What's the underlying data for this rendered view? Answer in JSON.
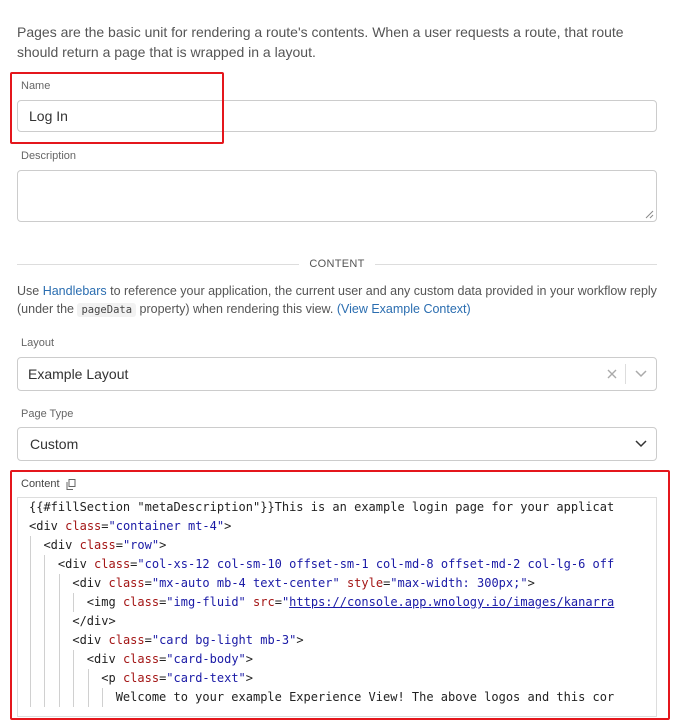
{
  "intro": "Pages are the basic unit for rendering a route's contents. When a user requests a route, that route should return a page that is wrapped in a layout.",
  "name_field": {
    "label": "Name",
    "value": "Log In"
  },
  "description_field": {
    "label": "Description",
    "value": ""
  },
  "content_divider": "CONTENT",
  "content_note": {
    "prefix": "Use ",
    "link_handlebars": "Handlebars",
    "middle": " to reference your application, the current user and any custom data provided in your workflow reply (under the ",
    "code": "pageData",
    "after_code": " property) when rendering this view. ",
    "link_example": "(View Example Context)"
  },
  "layout_field": {
    "label": "Layout",
    "value": "Example Layout"
  },
  "page_type_field": {
    "label": "Page Type",
    "value": "Custom"
  },
  "content_field": {
    "label": "Content"
  },
  "code_lines": [
    "{{#fillSection \"metaDescription\"}}This is an example login page for your applicat",
    "<div class=\"container mt-4\">",
    "  <div class=\"row\">",
    "    <div class=\"col-xs-12 col-sm-10 offset-sm-1 col-md-8 offset-md-2 col-lg-6 off",
    "      <div class=\"mx-auto mb-4 text-center\" style=\"max-width: 300px;\">",
    "        <img class=\"img-fluid\" src=\"https://console.app.wnology.io/images/kanarra",
    "      </div>",
    "      <div class=\"card bg-light mb-3\">",
    "        <div class=\"card-body\">",
    "          <p class=\"card-text\">",
    "            Welcome to your example Experience View! The above logos and this cor"
  ],
  "colors": {
    "highlight": "#e4161c",
    "link": "#2a6db0"
  }
}
